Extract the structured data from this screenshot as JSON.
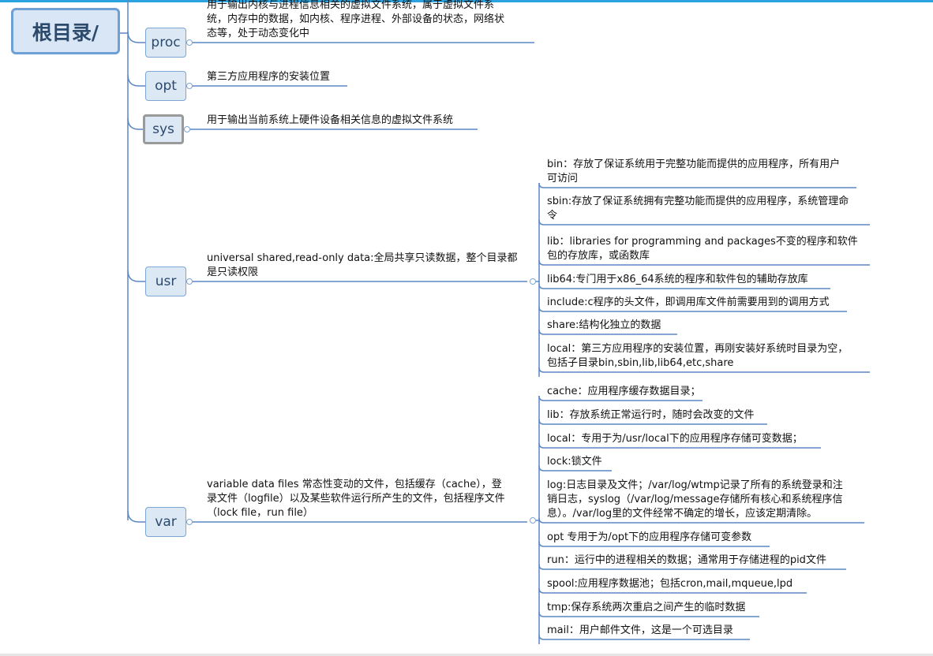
{
  "root": {
    "label": "根目录/"
  },
  "nodes": {
    "proc": {
      "label": "proc",
      "desc": [
        "用于输出内核与进程信息相关的虚拟文件系统，属于虚拟文件系",
        "统，内存中的数据，如内核、程序进程、外部设备的状态，网络状",
        "态等，处于动态变化中"
      ]
    },
    "opt": {
      "label": "opt",
      "desc": [
        "第三方应用程序的安装位置"
      ]
    },
    "sys": {
      "label": "sys",
      "desc": [
        "用于输出当前系统上硬件设备相关信息的虚拟文件系统"
      ]
    },
    "usr": {
      "label": "usr",
      "desc": [
        "universal shared,read-only data:全局共享只读数据，整个目录都",
        "是只读权限"
      ],
      "children": [
        [
          "bin：存放了保证系统用于完整功能而提供的应用程序，所有用户",
          "可访问"
        ],
        [
          "sbin:存放了保证系统拥有完整功能而提供的应用程序，系统管理命",
          "令"
        ],
        [
          "lib：libraries for programming and packages不变的程序和软件",
          "包的存放库，或函数库"
        ],
        [
          "lib64:专门用于x86_64系统的程序和软件包的辅助存放库"
        ],
        [
          "include:c程序的头文件，即调用库文件前需要用到的调用方式"
        ],
        [
          "share:结构化独立的数据"
        ],
        [
          "local：第三方应用程序的安装位置，再刚安装好系统时目录为空，",
          "包括子目录bin,sbin,lib,lib64,etc,share"
        ]
      ]
    },
    "var": {
      "label": "var",
      "desc": [
        "variable data files 常态性变动的文件，包括缓存（cache），登",
        "录文件（logfile）以及某些软件运行所产生的文件，包括程序文件",
        "（lock file，run file）"
      ],
      "children": [
        [
          "cache：应用程序缓存数据目录；"
        ],
        [
          "lib：存放系统正常运行时，随时会改变的文件"
        ],
        [
          "local：专用于为/usr/local下的应用程序存储可变数据；"
        ],
        [
          "lock:锁文件"
        ],
        [
          "log:日志目录及文件；/var/log/wtmp记录了所有的系统登录和注",
          "销日志，syslog（/var/log/message存储所有核心和系统程序信",
          "息）。/var/log里的文件经常不确定的增长，应该定期清除。"
        ],
        [
          "opt 专用于为/opt下的应用程序存储可变参数"
        ],
        [
          "run：运行中的进程相关的数据；通常用于存储进程的pid文件"
        ],
        [
          "spool:应用程序数据池；包括cron,mail,mqueue,lpd"
        ],
        [
          "tmp:保存系统两次重启之间产生的临时数据"
        ],
        [
          "mail：用户邮件文件，这是一个可选目录"
        ]
      ]
    }
  }
}
